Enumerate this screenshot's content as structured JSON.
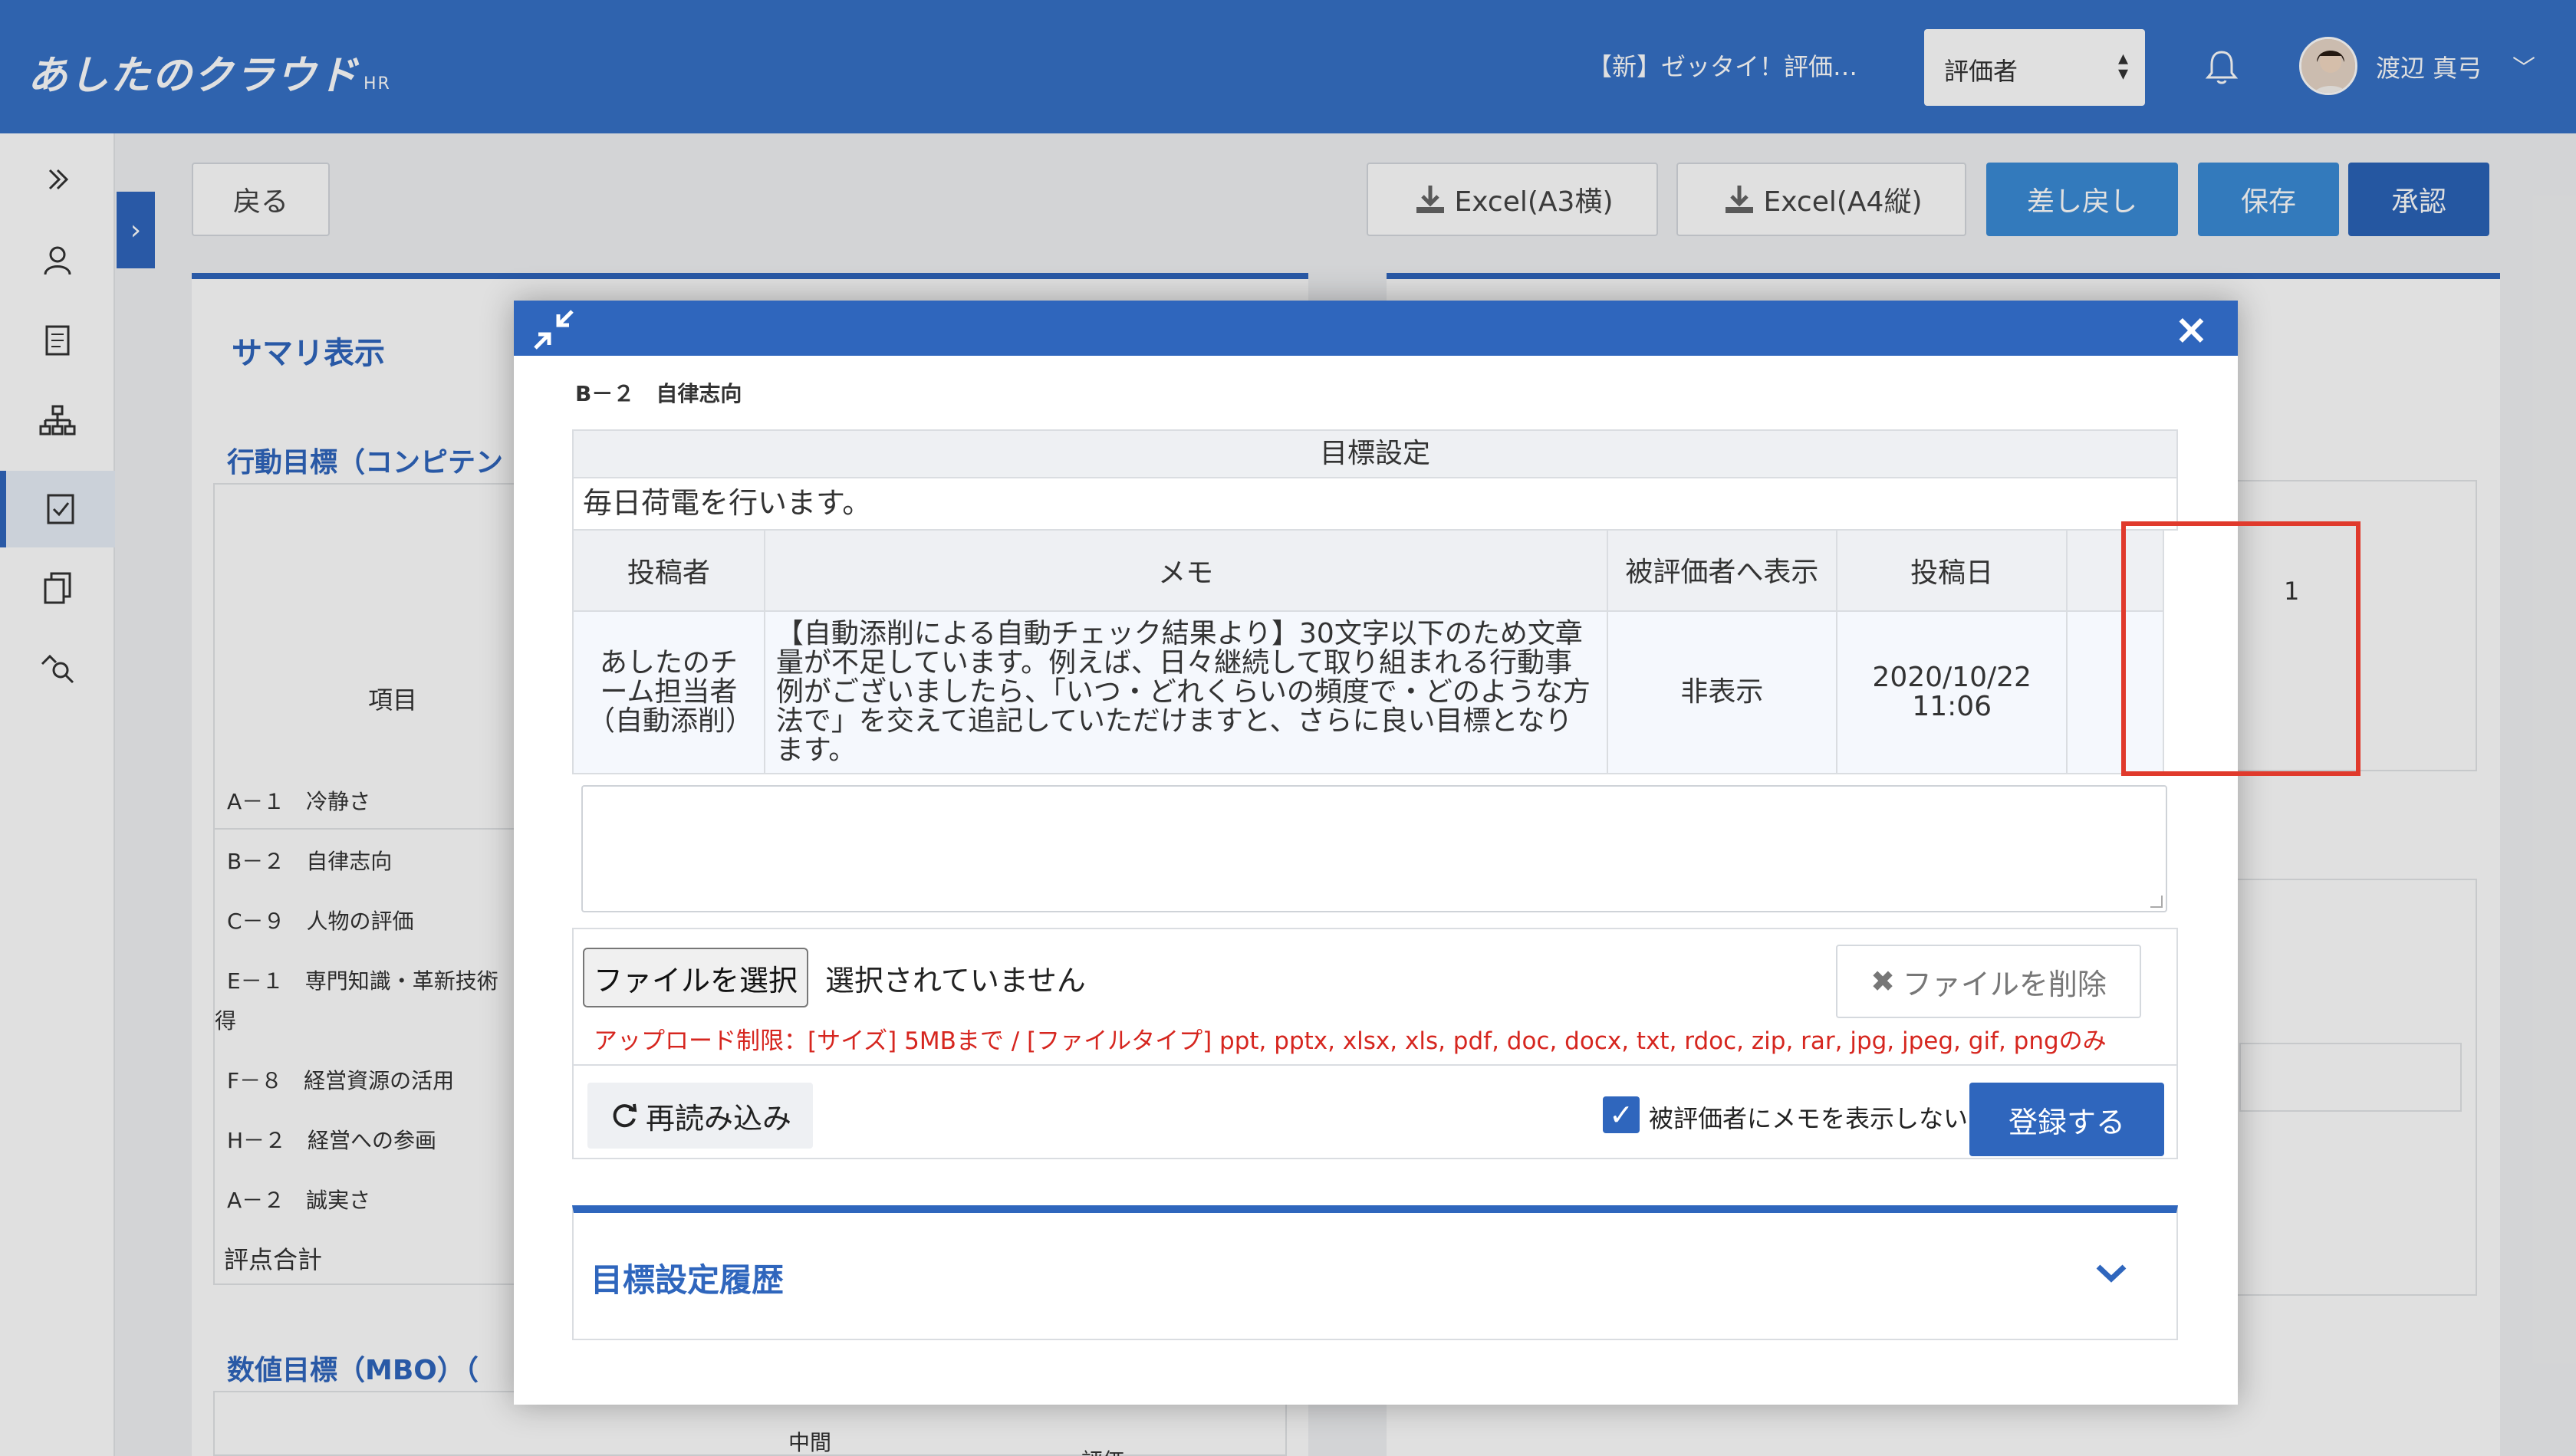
{
  "header": {
    "logo_text": "あしたのクラウド",
    "logo_sub": "HR",
    "company_name": "【新】ゼッタイ！評価…",
    "role_select_value": "評価者",
    "user_name": "渡辺 真弓"
  },
  "toolbar": {
    "back_label": "戻る",
    "excel_a3_label": "Excel(A3横)",
    "excel_a4_label": "Excel(A4縦)",
    "return_label": "差し戻し",
    "save_label": "保存",
    "approve_label": "承認"
  },
  "background": {
    "summary_title": "サマリ表示",
    "competency_title": "行動目標（コンピテン",
    "item_header": "項目",
    "items": [
      "A－１　冷静さ",
      "B－２　自律志向",
      "C－９　人物の評価",
      "E－１　専門知識・革新技術",
      "F－８　経営資源の活用",
      "H－２　経営への参画",
      "A－２　誠実さ"
    ],
    "item_wrap": "得",
    "total_label": "評点合計",
    "mbo_title": "数値目標（MBO）（",
    "mid_label": "中間",
    "eval_label": "評価",
    "right_value": "1"
  },
  "modal": {
    "item_code": "B－２　自律志向",
    "goal_setting_header": "目標設定",
    "goal_text": "毎日荷電を行います。",
    "memo_table": {
      "headers": [
        "投稿者",
        "メモ",
        "被評価者へ表示",
        "投稿日",
        ""
      ],
      "row": {
        "poster": "あしたのチーム担当者（自動添削）",
        "memo": "【自動添削による自動チェック結果より】30文字以下のため文章量が不足しています。例えば、日々継続して取り組まれる行動事例がございましたら、「いつ・どれくらいの頻度で・どのような方法で」を交えて追記していただけますと、さらに良い目標となります。",
        "visibility": "非表示",
        "posted_date": "2020/10/22",
        "posted_time": "11:06"
      }
    },
    "memo_input_placeholder": "",
    "file_choose_label": "ファイルを選択",
    "file_status": "選択されていません",
    "file_delete_label": "ファイルを削除",
    "upload_note": "アップロード制限：[サイズ] 5MBまで / [ファイルタイプ] ppt, pptx, xlsx, xls, pdf, doc, docx, txt, rdoc, zip, rar, jpg, jpeg, gif, pngのみ",
    "reload_label": "再読み込み",
    "hide_memo_label": "被評価者にメモを表示しない",
    "hide_memo_checked": true,
    "register_label": "登録する",
    "history_title": "目標設定履歴"
  },
  "colors": {
    "primary": "#3671c6",
    "accent": "#2f66bd",
    "highlight": "#e03a2c",
    "warning_text": "#d6261f"
  }
}
